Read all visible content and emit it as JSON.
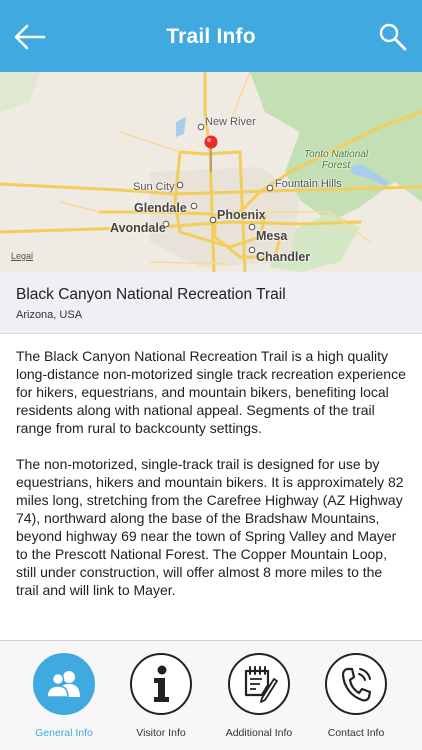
{
  "header": {
    "title": "Trail Info",
    "back_icon": "arrow-left-icon",
    "search_icon": "search-icon"
  },
  "map": {
    "labels": {
      "new_river": "New River",
      "tonto": "Tonto National\nForest",
      "sun_city": "Sun City",
      "fountain_hills": "Fountain Hills",
      "glendale": "Glendale",
      "phoenix": "Phoenix",
      "avondale": "Avondale",
      "mesa": "Mesa",
      "chandler": "Chandler"
    },
    "legal": "Legal",
    "colors": {
      "land": "#efeae2",
      "green": "#c4dfb4",
      "road": "#f3cd5a",
      "pin": "#e52b2b"
    }
  },
  "trail": {
    "name": "Black Canyon National Recreation Trail",
    "location": "Arizona, USA"
  },
  "description": [
    "The Black Canyon National Recreation Trail is a high quality long-distance non-motorized single track recreation experience for hikers, equestrians, and mountain bikers, benefiting local residents along with national appeal. Segments of the trail range from rural to backcounty settings.",
    "The non-motorized, single-track trail is designed for use by equestrians, hikers and mountain bikers. It is approximately 82 miles long, stretching from the Carefree Highway (AZ Highway 74), northward along the base of the Bradshaw Mountains, beyond highway 69 near the town of Spring Valley and Mayer to the Prescott National Forest. The Copper Mountain Loop, still under construction, will offer almost 8 more miles to the trail and will link to Mayer."
  ],
  "tabs": [
    {
      "label": "General Info",
      "icon": "people-icon",
      "active": true
    },
    {
      "label": "Visitor Info",
      "icon": "info-icon",
      "active": false
    },
    {
      "label": "Additional Info",
      "icon": "notepad-pencil-icon",
      "active": false
    },
    {
      "label": "Contact Info",
      "icon": "phone-icon",
      "active": false
    }
  ],
  "colors": {
    "accent": "#3fa9e0",
    "header_bg": "#3fa9e0",
    "section_bg": "#efeff4"
  }
}
